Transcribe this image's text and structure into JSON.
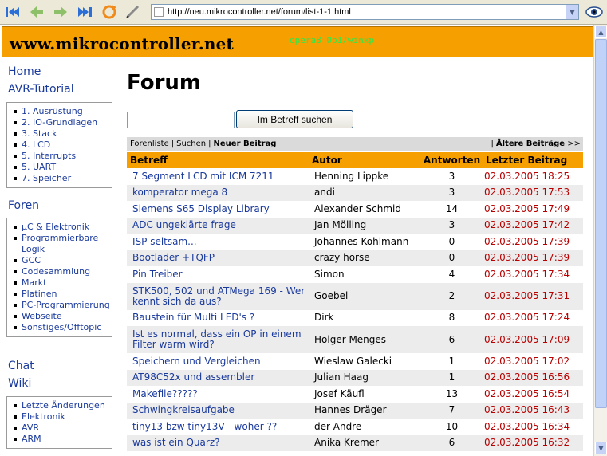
{
  "browser": {
    "url": "http://neu.mikrocontroller.net/forum/list-1-1.html"
  },
  "site": {
    "title": "www.mikrocontroller.net",
    "ua_text": "opera8 0b1/winxp"
  },
  "sidebar": {
    "home": "Home",
    "avr_tutorial": "AVR-Tutorial",
    "tutorial_items": [
      "1. Ausrüstung",
      "2. IO-Grundlagen",
      "3. Stack",
      "4. LCD",
      "5. Interrupts",
      "5. UART",
      "7. Speicher"
    ],
    "foren": "Foren",
    "foren_items": [
      "µC & Elektronik",
      "Programmierbare Logik",
      "GCC",
      "Codesammlung",
      "Markt",
      "Platinen",
      "PC-Programmierung",
      "Webseite",
      "Sonstiges/Offtopic"
    ],
    "chat": "Chat",
    "wiki": "Wiki",
    "wiki_items": [
      "Letzte Änderungen",
      "Elektronik",
      "AVR",
      "ARM"
    ]
  },
  "main": {
    "page_title": "Forum",
    "search_placeholder": "",
    "search_button": "Im Betreff suchen",
    "nav": {
      "forenliste": "Forenliste",
      "suchen": "Suchen",
      "neuer_beitrag": "Neuer Beitrag",
      "aeltere": "Ältere Beiträge",
      "arrows": ">>"
    },
    "columns": [
      "Betreff",
      "Autor",
      "Antworten",
      "Letzter Beitrag"
    ],
    "rows": [
      {
        "subject": "7 Segment LCD mit ICM 7211",
        "author": "Henning Lippke",
        "answers": "3",
        "last": "02.03.2005 18:25"
      },
      {
        "subject": "komperator mega 8",
        "author": "andi",
        "answers": "3",
        "last": "02.03.2005 17:53"
      },
      {
        "subject": "Siemens S65 Display Library",
        "author": "Alexander Schmid",
        "answers": "14",
        "last": "02.03.2005 17:49"
      },
      {
        "subject": "ADC ungeklärte frage",
        "author": "Jan Mölling",
        "answers": "3",
        "last": "02.03.2005 17:42"
      },
      {
        "subject": "ISP seltsam...",
        "author": "Johannes Kohlmann",
        "answers": "0",
        "last": "02.03.2005 17:39"
      },
      {
        "subject": "Bootlader +TQFP",
        "author": "crazy horse",
        "answers": "0",
        "last": "02.03.2005 17:39"
      },
      {
        "subject": "Pin Treiber",
        "author": "Simon",
        "answers": "4",
        "last": "02.03.2005 17:34"
      },
      {
        "subject": "STK500, 502 und ATMega 169 - Wer kennt sich da aus?",
        "author": "Goebel",
        "answers": "2",
        "last": "02.03.2005 17:31"
      },
      {
        "subject": "Baustein für Multi LED's ?",
        "author": "Dirk",
        "answers": "8",
        "last": "02.03.2005 17:24"
      },
      {
        "subject": "Ist es normal, dass ein OP in einem Filter warm wird?",
        "author": "Holger Menges",
        "answers": "6",
        "last": "02.03.2005 17:09"
      },
      {
        "subject": "Speichern und Vergleichen",
        "author": "Wieslaw Galecki",
        "answers": "1",
        "last": "02.03.2005 17:02"
      },
      {
        "subject": "AT98C52x und assembler",
        "author": "Julian Haag",
        "answers": "1",
        "last": "02.03.2005 16:56"
      },
      {
        "subject": "Makefile?????",
        "author": "Josef Käufl",
        "answers": "13",
        "last": "02.03.2005 16:54"
      },
      {
        "subject": "Schwingkreisaufgabe",
        "author": "Hannes Dräger",
        "answers": "7",
        "last": "02.03.2005 16:43"
      },
      {
        "subject": "tiny13 bzw tiny13V - woher ??",
        "author": "der Andre",
        "answers": "10",
        "last": "02.03.2005 16:34"
      },
      {
        "subject": "was ist ein Quarz?",
        "author": "Anika Kremer",
        "answers": "6",
        "last": "02.03.2005 16:32"
      }
    ]
  }
}
